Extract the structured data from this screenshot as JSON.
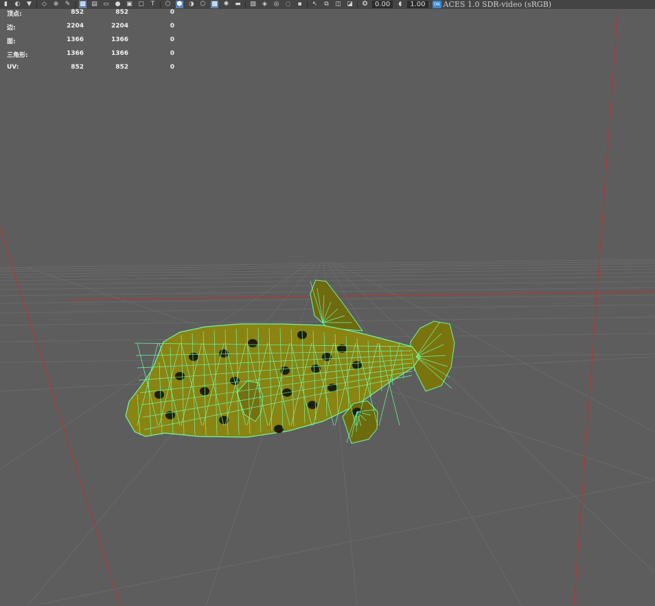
{
  "toolbar": {
    "exposure": "0.00",
    "gamma": "1.00",
    "colorspace_badge": "ON",
    "colorspace": "ACES 1.0 SDR-video (sRGB)"
  },
  "hud": {
    "rows": [
      {
        "label": "顶点:",
        "a": "852",
        "b": "852",
        "c": "0"
      },
      {
        "label": "边:",
        "a": "2204",
        "b": "2204",
        "c": "0"
      },
      {
        "label": "面:",
        "a": "1366",
        "b": "1366",
        "c": "0"
      },
      {
        "label": "三角形:",
        "a": "1366",
        "b": "1366",
        "c": "0"
      },
      {
        "label": "UV:",
        "a": "852",
        "b": "852",
        "c": "0"
      }
    ]
  },
  "colors": {
    "viewport_bg": "#5d5d5d",
    "grid_line": "#6a6a6a",
    "axis_red": "#c0302c",
    "wireframe": "#6dfaa6",
    "fish_body": "#8a8412",
    "fish_spot": "#1e1e08"
  }
}
